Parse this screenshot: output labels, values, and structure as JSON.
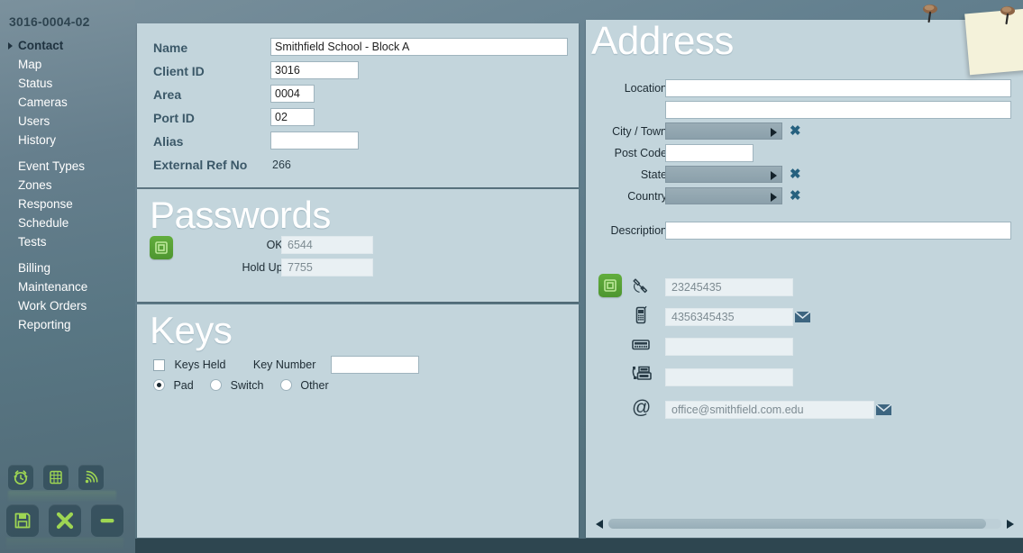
{
  "sidebar": {
    "title": "3016-0004-02",
    "items": [
      {
        "label": "Contact",
        "active": true
      },
      {
        "label": "Map",
        "active": false
      },
      {
        "label": "Status",
        "active": false
      },
      {
        "label": "Cameras",
        "active": false
      },
      {
        "label": "Users",
        "active": false
      },
      {
        "label": "History",
        "active": false
      },
      {
        "label": "Event Types",
        "active": false,
        "gap_before": true
      },
      {
        "label": "Zones",
        "active": false
      },
      {
        "label": "Response",
        "active": false
      },
      {
        "label": "Schedule",
        "active": false
      },
      {
        "label": "Tests",
        "active": false
      },
      {
        "label": "Billing",
        "active": false,
        "gap_before": true
      },
      {
        "label": "Maintenance",
        "active": false
      },
      {
        "label": "Work Orders",
        "active": false
      },
      {
        "label": "Reporting",
        "active": false
      }
    ],
    "toolbar": {
      "row1": [
        {
          "icon": "alarm-clock-icon",
          "name": "alarm-button"
        },
        {
          "icon": "globe-grid-icon",
          "name": "network-button"
        },
        {
          "icon": "signal-waves-icon",
          "name": "signal-button"
        }
      ],
      "row2": [
        {
          "icon": "save-floppy-icon",
          "name": "save-button"
        },
        {
          "icon": "close-x-icon",
          "name": "cancel-button"
        },
        {
          "icon": "minus-icon",
          "name": "remove-button"
        }
      ]
    }
  },
  "contact": {
    "fields": [
      {
        "label": "Name",
        "value": "Smithfield School - Block A"
      },
      {
        "label": "Client ID",
        "value": "3016"
      },
      {
        "label": "Area",
        "value": "0004"
      },
      {
        "label": "Port ID",
        "value": "02"
      },
      {
        "label": "Alias",
        "value": ""
      }
    ],
    "external_ref_label": "External Ref No",
    "external_ref_value": "266"
  },
  "passwords": {
    "heading": "Passwords",
    "ok_label": "OK Password",
    "ok_value": "6544",
    "holdup_label": "Hold Up Password",
    "holdup_value": "7755"
  },
  "keys": {
    "heading": "Keys",
    "keys_held_label": "Keys Held",
    "keys_held_checked": false,
    "key_number_label": "Key Number",
    "key_number_value": "",
    "options": [
      {
        "label": "Pad",
        "selected": true
      },
      {
        "label": "Switch",
        "selected": false
      },
      {
        "label": "Other",
        "selected": false
      }
    ]
  },
  "address": {
    "heading": "Address",
    "location_label": "Location",
    "location_line1": "",
    "location_line2": "",
    "city_label": "City / Town",
    "city_value": "",
    "postcode_label": "Post Code",
    "postcode_value": "",
    "state_label": "State",
    "state_value": "",
    "country_label": "Country",
    "country_value": "",
    "description_label": "Description",
    "description_value": "",
    "clear_symbol": "✖"
  },
  "contact_details": {
    "rows": [
      {
        "icon": "telephone-handset-icon",
        "value": "23245435",
        "has_envelope": false
      },
      {
        "icon": "mobile-phone-icon",
        "value": "4356345435",
        "has_envelope": true
      },
      {
        "icon": "pager-icon",
        "value": "",
        "has_envelope": false
      },
      {
        "icon": "fax-machine-icon",
        "value": "",
        "has_envelope": false
      },
      {
        "icon": "at-sign-icon",
        "value": "office@smithfield.com.edu",
        "has_envelope": true
      }
    ]
  },
  "colors": {
    "panel": "#c3d5dc",
    "sidebar": "#5d7a8a",
    "accent_green": "#5aa438",
    "label_blue": "#3b5868",
    "dark_strip": "#2e4650",
    "sticky_note": "#f4f2da"
  }
}
